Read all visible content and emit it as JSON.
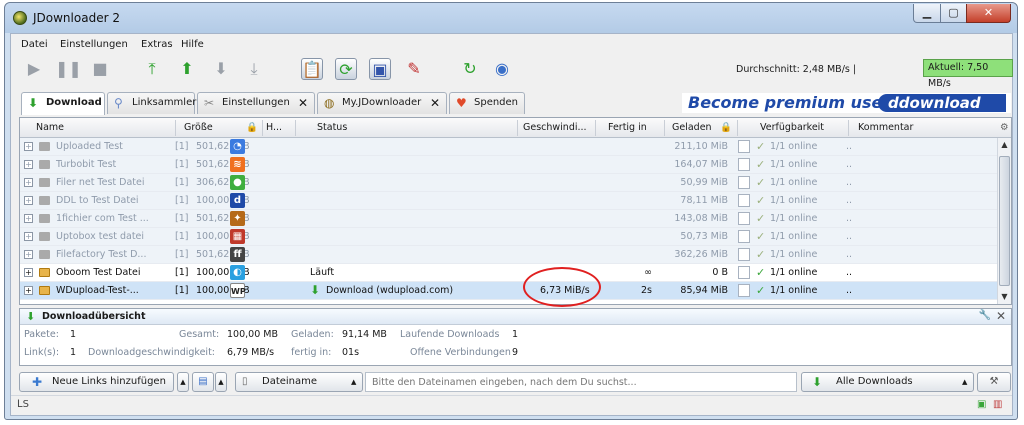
{
  "window": {
    "title": "JDownloader 2"
  },
  "menu": [
    "Datei",
    "Einstellungen",
    "Extras",
    "Hilfe"
  ],
  "speed": {
    "average": "Durchschnitt: 2,48 MB/s |",
    "current": "Aktuell: 7,50 MB/s"
  },
  "tabs": [
    {
      "label": "Download",
      "icon": "download-arrow-icon"
    },
    {
      "label": "Linksammler",
      "icon": "link-grabber-icon"
    },
    {
      "label": "Einstellungen",
      "icon": "settings-tools-icon"
    },
    {
      "label": "My.JDownloader",
      "icon": "myjd-icon"
    },
    {
      "label": "Spenden",
      "icon": "heart-icon"
    }
  ],
  "premium_banner": {
    "text": "Become premium user",
    "brand": "ddownload"
  },
  "columns": [
    "Name",
    "Größe",
    "H...",
    "Status",
    "Geschwindi...",
    "Fertig in",
    "Geladen",
    "Verfügbarkeit",
    "Kommentar"
  ],
  "rows": [
    {
      "name": "Uploaded Test",
      "count": "[1]",
      "size": "501,62 MiB",
      "hoster_color": "#3b7be0",
      "hoster_glyph": "◔",
      "status": "",
      "speed": "",
      "eta": "",
      "loaded": "211,10 MiB",
      "availability": "1/1 online",
      "comment": "..",
      "state": "disabled"
    },
    {
      "name": "Turbobit Test",
      "count": "[1]",
      "size": "501,62 MiB",
      "hoster_color": "#f07020",
      "hoster_glyph": "≋",
      "status": "",
      "speed": "",
      "eta": "",
      "loaded": "164,07 MiB",
      "availability": "1/1 online",
      "comment": "..",
      "state": "disabled"
    },
    {
      "name": "Filer net Test Datei",
      "count": "[1]",
      "size": "306,62 MiB",
      "hoster_color": "#3fae3f",
      "hoster_glyph": "●",
      "status": "",
      "speed": "",
      "eta": "",
      "loaded": "50,99 MiB",
      "availability": "1/1 online",
      "comment": "..",
      "state": "disabled"
    },
    {
      "name": "DDL to Test Datei",
      "count": "[1]",
      "size": "100,00 MiB",
      "hoster_color": "#1f4aa8",
      "hoster_glyph": "d",
      "status": "",
      "speed": "",
      "eta": "",
      "loaded": "78,11 MiB",
      "availability": "1/1 online",
      "comment": "..",
      "state": "disabled"
    },
    {
      "name": "1fichier com Test ...",
      "count": "[1]",
      "size": "501,62 MiB",
      "hoster_color": "#b56a1a",
      "hoster_glyph": "✦",
      "status": "",
      "speed": "",
      "eta": "",
      "loaded": "143,08 MiB",
      "availability": "1/1 online",
      "comment": "..",
      "state": "disabled"
    },
    {
      "name": "Uptobox test datei",
      "count": "[1]",
      "size": "100,00 MiB",
      "hoster_color": "#c0392b",
      "hoster_glyph": "▦",
      "status": "",
      "speed": "",
      "eta": "",
      "loaded": "50,73 MiB",
      "availability": "1/1 online",
      "comment": "..",
      "state": "disabled"
    },
    {
      "name": "Filefactory Test D...",
      "count": "[1]",
      "size": "501,62 MiB",
      "hoster_color": "#444444",
      "hoster_glyph": "ff",
      "status": "",
      "speed": "",
      "eta": "",
      "loaded": "362,26 MiB",
      "availability": "1/1 online",
      "comment": "..",
      "state": "disabled"
    },
    {
      "name": "Oboom Test Datei",
      "count": "[1]",
      "size": "100,00 MiB",
      "hoster_color": "#2aa0e0",
      "hoster_glyph": "◐",
      "status": "Läuft",
      "speed": "",
      "eta": "∞",
      "loaded": "0 B",
      "availability": "1/1 online",
      "comment": "..",
      "state": "active"
    },
    {
      "name": "WDupload-Test-...",
      "count": "[1]",
      "size": "100,00 MiB",
      "hoster_color": "#ffffff",
      "hoster_glyph": "WP",
      "status": "Download (wdupload.com)",
      "speed": "6,73 MiB/s",
      "eta": "2s",
      "loaded": "85,94 MiB",
      "availability": "1/1 online",
      "comment": "..",
      "state": "selected"
    }
  ],
  "overview": {
    "title": "Downloadübersicht",
    "packages_label": "Pakete:",
    "packages": "1",
    "total_label": "Gesamt:",
    "total": "100,00 MB",
    "loaded_label": "Geladen:",
    "loaded": "91,14 MB",
    "running_label": "Laufende Downloads",
    "running": "1",
    "links_label": "Link(s):",
    "links": "1",
    "dlspeed_label": "Downloadgeschwindigkeit:",
    "dlspeed": "6,79 MB/s",
    "eta_label": "fertig in:",
    "eta": "01s",
    "connections_label": "Offene Verbindungen",
    "connections": "9"
  },
  "bottom": {
    "add_links": "Neue Links hinzufügen",
    "filename_label": "Dateiname",
    "search_placeholder": "Bitte den Dateinamen eingeben, nach dem Du suchst...",
    "all_downloads": "Alle Downloads"
  },
  "colors": {
    "accent": "#1f4aa8",
    "speed_ok": "#8ee07a",
    "annotation": "#e02020"
  }
}
